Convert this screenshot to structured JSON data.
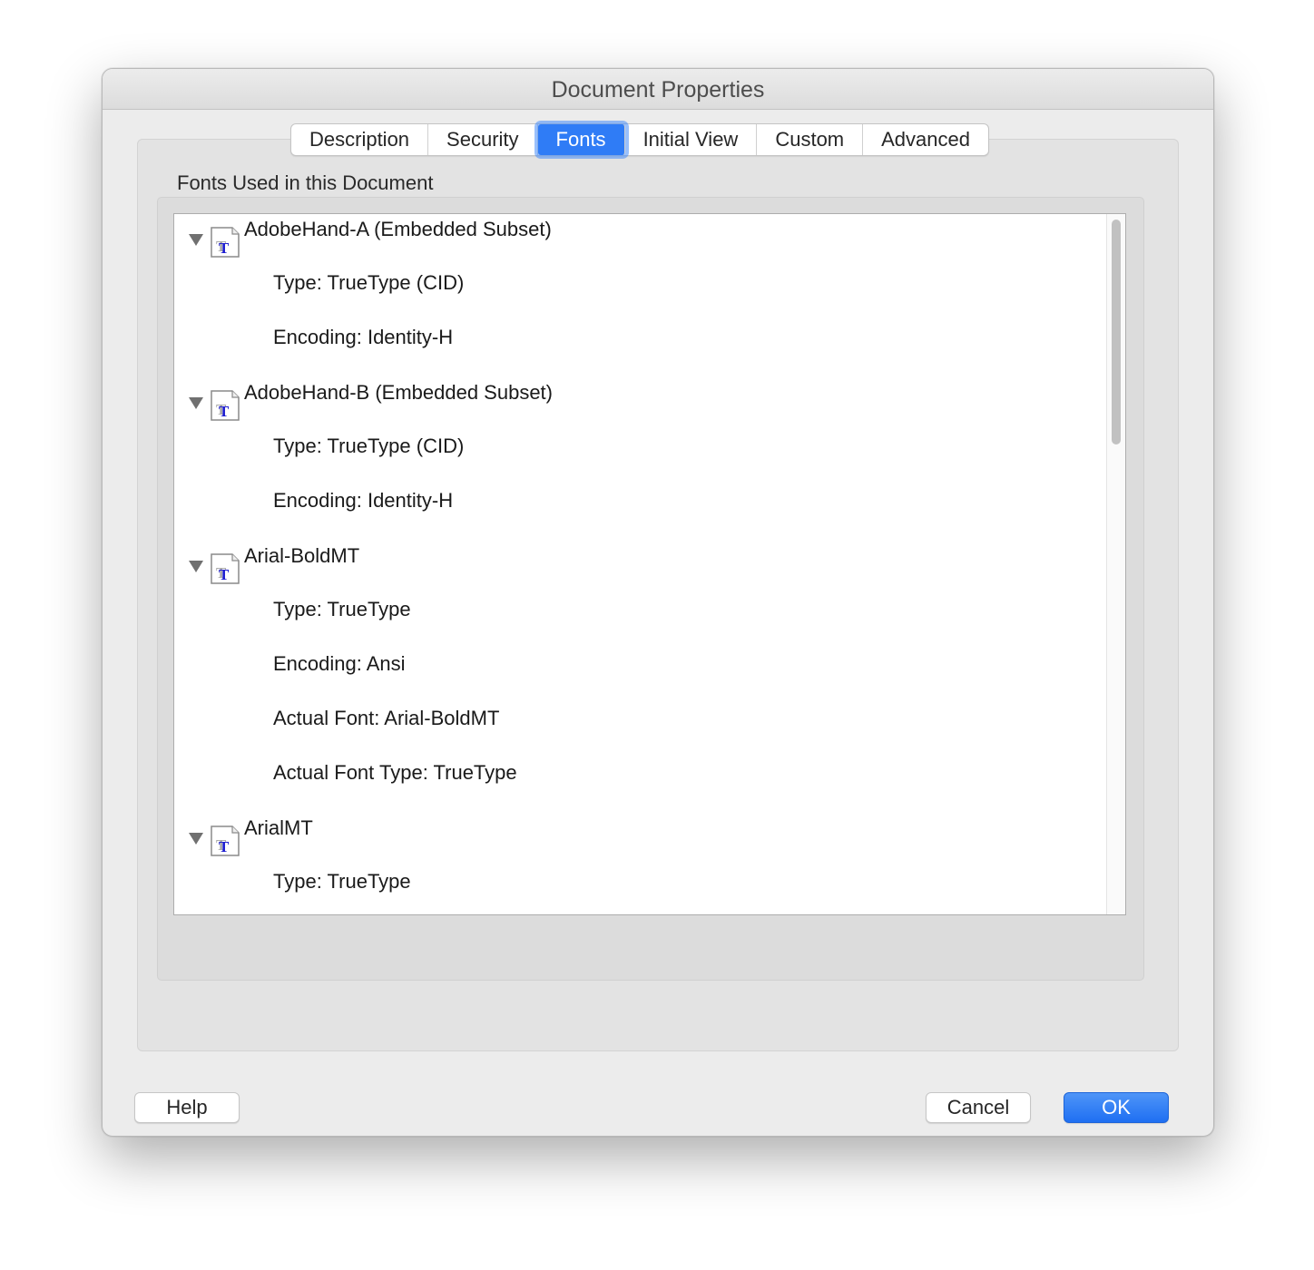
{
  "window": {
    "title": "Document Properties"
  },
  "tabs": [
    {
      "label": "Description",
      "active": false
    },
    {
      "label": "Security",
      "active": false
    },
    {
      "label": "Fonts",
      "active": true
    },
    {
      "label": "Initial View",
      "active": false
    },
    {
      "label": "Custom",
      "active": false
    },
    {
      "label": "Advanced",
      "active": false
    }
  ],
  "fonts_group": {
    "label": "Fonts Used in this Document",
    "fonts": [
      {
        "name": "AdobeHand-A (Embedded Subset)",
        "icon": "truetype-font-icon",
        "properties": [
          "Type: TrueType (CID)",
          "Encoding: Identity-H"
        ]
      },
      {
        "name": "AdobeHand-B (Embedded Subset)",
        "icon": "truetype-font-icon",
        "properties": [
          "Type: TrueType (CID)",
          "Encoding: Identity-H"
        ]
      },
      {
        "name": "Arial-BoldMT",
        "icon": "truetype-font-icon",
        "properties": [
          "Type: TrueType",
          "Encoding: Ansi",
          "Actual Font: Arial-BoldMT",
          "Actual Font Type: TrueType"
        ]
      },
      {
        "name": "ArialMT",
        "icon": "truetype-font-icon",
        "properties": [
          "Type: TrueType"
        ]
      }
    ]
  },
  "buttons": {
    "help": "Help",
    "cancel": "Cancel",
    "ok": "OK"
  },
  "colors": {
    "accent": "#2f7cf6",
    "window_bg": "#ececec"
  }
}
